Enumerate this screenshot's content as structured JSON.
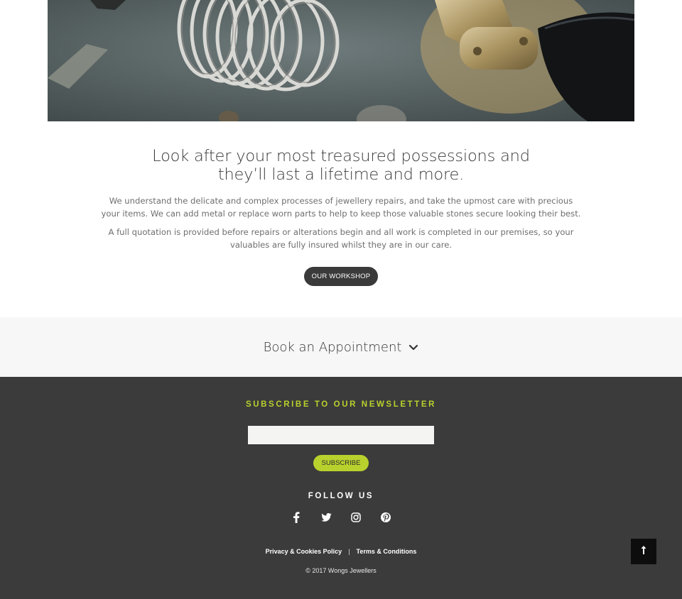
{
  "hero": {
    "image_alt_icon": "ring-sizer-photo"
  },
  "intro": {
    "heading": "Look after your most treasured possessions and they’ll last a lifetime and more.",
    "paragraph_1": "We understand the delicate and complex processes of jewellery repairs, and take the upmost care with precious your items. We can add metal or replace worn parts to help to keep those valuable stones secure looking their best.",
    "paragraph_2": "A full quotation is provided before repairs or alterations begin and all work is completed in our premises, so your valuables are fully insured whilst they are in our care.",
    "button_label": "OUR WORKSHOP"
  },
  "appointment": {
    "label": "Book an Appointment",
    "icon": "chevron-down-icon"
  },
  "footer": {
    "newsletter_title": "SUBSCRIBE TO OUR NEWSLETTER",
    "email_placeholder": "",
    "subscribe_label": "SUBSCRIBE",
    "follow_title": "FOLLOW US",
    "socials": [
      "facebook-icon",
      "twitter-icon",
      "instagram-icon",
      "pinterest-icon"
    ],
    "links": {
      "privacy": "Privacy & Cookies Policy",
      "separator": "|",
      "terms": "Terms & Conditions"
    },
    "copyright": "© 2017 Wongs Jewellers"
  },
  "colors": {
    "accent": "#b9d12d",
    "footer_bg": "#3b3b3b",
    "band_bg": "#f7f7f7",
    "button_dark": "#3a3a3a"
  }
}
